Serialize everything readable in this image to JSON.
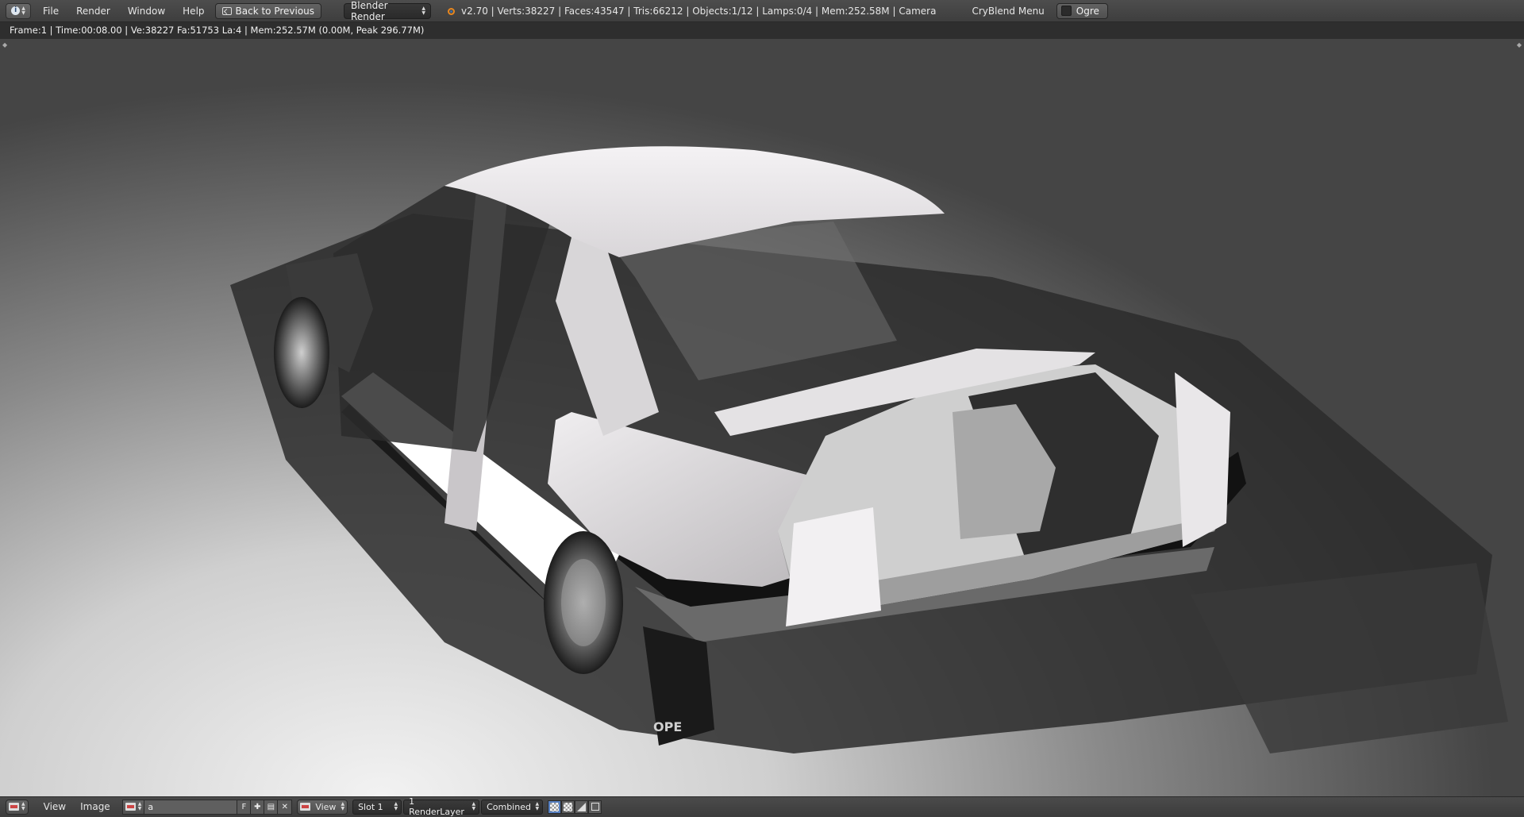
{
  "topbar": {
    "menus": [
      "File",
      "Render",
      "Window",
      "Help"
    ],
    "back_button": "Back to Previous",
    "render_engine": "Blender Render",
    "stats": "v2.70 | Verts:38227 | Faces:43547 | Tris:66212 | Objects:1/12 | Lamps:0/4 | Mem:252.58M | Camera",
    "cryblend_menu": "CryBlend Menu",
    "ogre_label": "Ogre"
  },
  "render_info": "Frame:1 | Time:00:08.00 | Ve:38227 Fa:51753 La:4 | Mem:252.57M (0.00M, Peak 296.77M)",
  "bottombar": {
    "menus": [
      "View",
      "Image"
    ],
    "image_name": "a",
    "fake_user_label": "F",
    "view_select": "View",
    "slot": "Slot 1",
    "render_layer": "1 RenderLayer",
    "pass": "Combined"
  },
  "render_image": {
    "subject": "rendered car body, white, rear three-quarter view",
    "plate_text": "OPE"
  },
  "colors": {
    "header_bg": "#454545",
    "info_bg": "#2e2e2e",
    "accent_orange": "#e8871f",
    "active_blue": "#5680c2"
  }
}
